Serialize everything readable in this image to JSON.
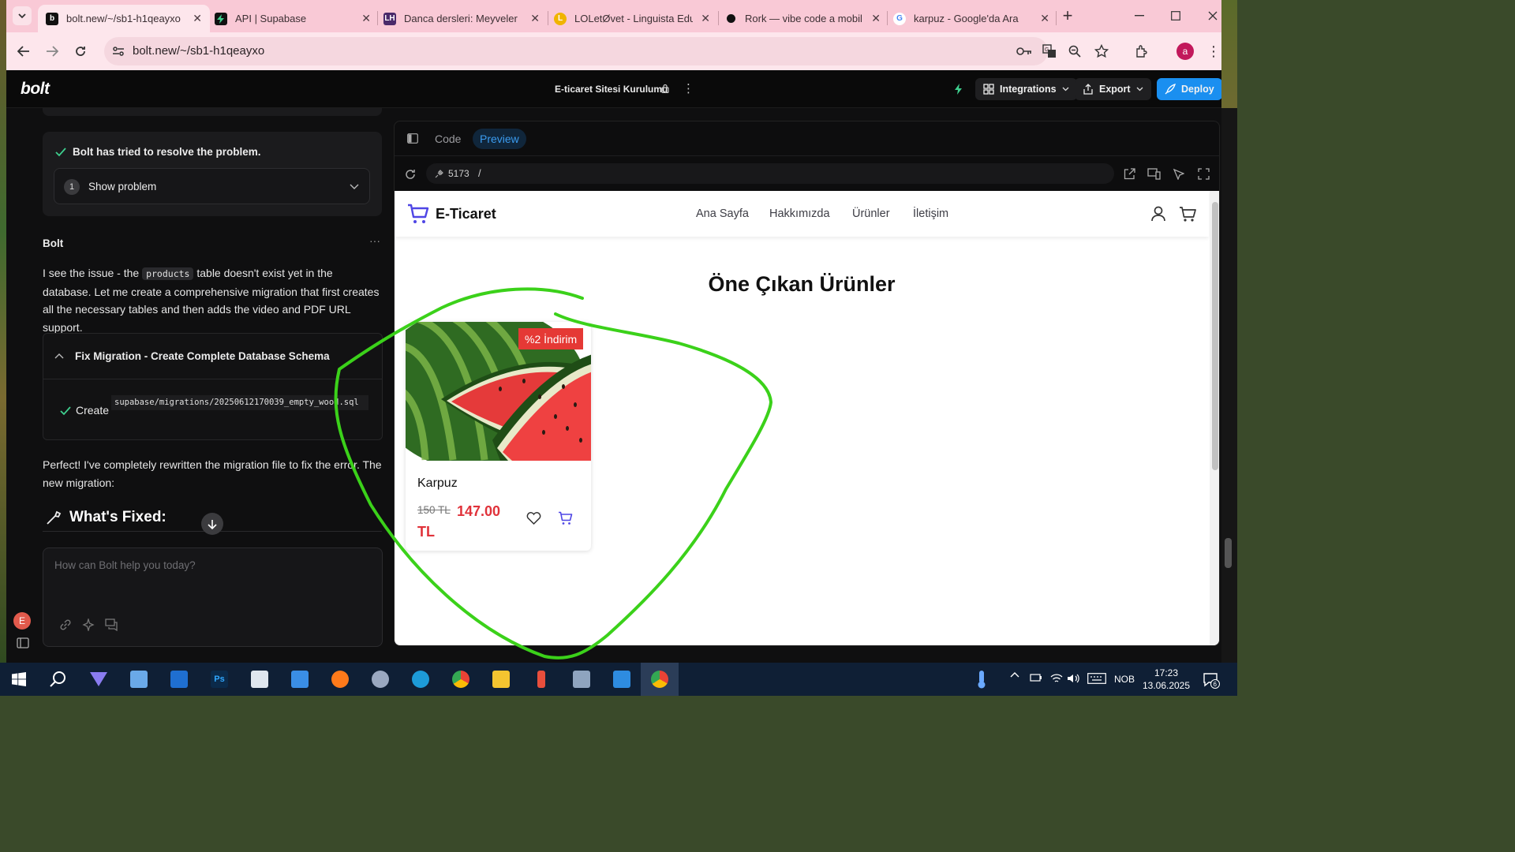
{
  "browser": {
    "tabs": [
      {
        "title": "bolt.new/~/sb1-h1qeayxo",
        "active": true,
        "icon": "bolt-favicon"
      },
      {
        "title": "API | Supabase",
        "active": false,
        "icon": "supabase-favicon"
      },
      {
        "title": "Danca dersleri: Meyveler",
        "active": false,
        "icon": "lh-favicon"
      },
      {
        "title": "LOLetØvet - Linguista Edu",
        "active": false,
        "icon": "linguista-favicon"
      },
      {
        "title": "Rork — vibe code a mobil",
        "active": false,
        "icon": "rork-favicon"
      },
      {
        "title": "karpuz - Google'da Ara",
        "active": false,
        "icon": "google-favicon"
      }
    ],
    "new_tab": "+",
    "url": "bolt.new/~/sb1-h1qeayxo",
    "profile_initial": "a"
  },
  "bolt": {
    "logo": "bolt",
    "project_title": "E-ticaret Sitesi Kurulumu",
    "integrations_label": "Integrations",
    "export_label": "Export",
    "deploy_label": "Deploy"
  },
  "chat": {
    "problem_status": "Bolt has tried to resolve the problem.",
    "show_problem_number": "1",
    "show_problem_label": "Show problem",
    "author": "Bolt",
    "more": "···",
    "msg1_before": "I see the issue - the ",
    "msg1_code": "products",
    "msg1_after": " table doesn't exist yet in the database. Let me create a comprehensive migration that first creates all the necessary tables and then adds the video and PDF URL support.",
    "artifact_title": "Fix Migration - Create Complete Database Schema",
    "artifact_action": "Create",
    "artifact_path": "supabase/migrations/20250612170039_empty_wood.sql",
    "msg2": "Perfect! I've completely rewritten the migration file to fix the error. The new migration:",
    "section_heading": "What's Fixed:",
    "prompt_placeholder": "How can Bolt help you today?",
    "user_avatar": "E"
  },
  "workbench": {
    "tab_code": "Code",
    "tab_preview": "Preview",
    "port": "5173",
    "path": "/"
  },
  "site": {
    "brand": "E-Ticaret",
    "nav": [
      "Ana Sayfa",
      "Hakkımızda",
      "Ürünler",
      "İletişim"
    ],
    "featured_title": "Öne Çıkan Ürünler",
    "product": {
      "name": "Karpuz",
      "badge": "%2 İndirim",
      "old_price": "150 TL",
      "new_price": "147.00 TL"
    }
  },
  "taskbar": {
    "lang": "NOB",
    "time": "17:23",
    "date": "13.06.2025",
    "notifications": "6"
  },
  "colors": {
    "tab_strip": "#f9c9d6",
    "deploy": "#1a8ff0",
    "price": "#e0323a",
    "brand_cart": "#4f46e5",
    "annotation": "#3bd11a"
  }
}
